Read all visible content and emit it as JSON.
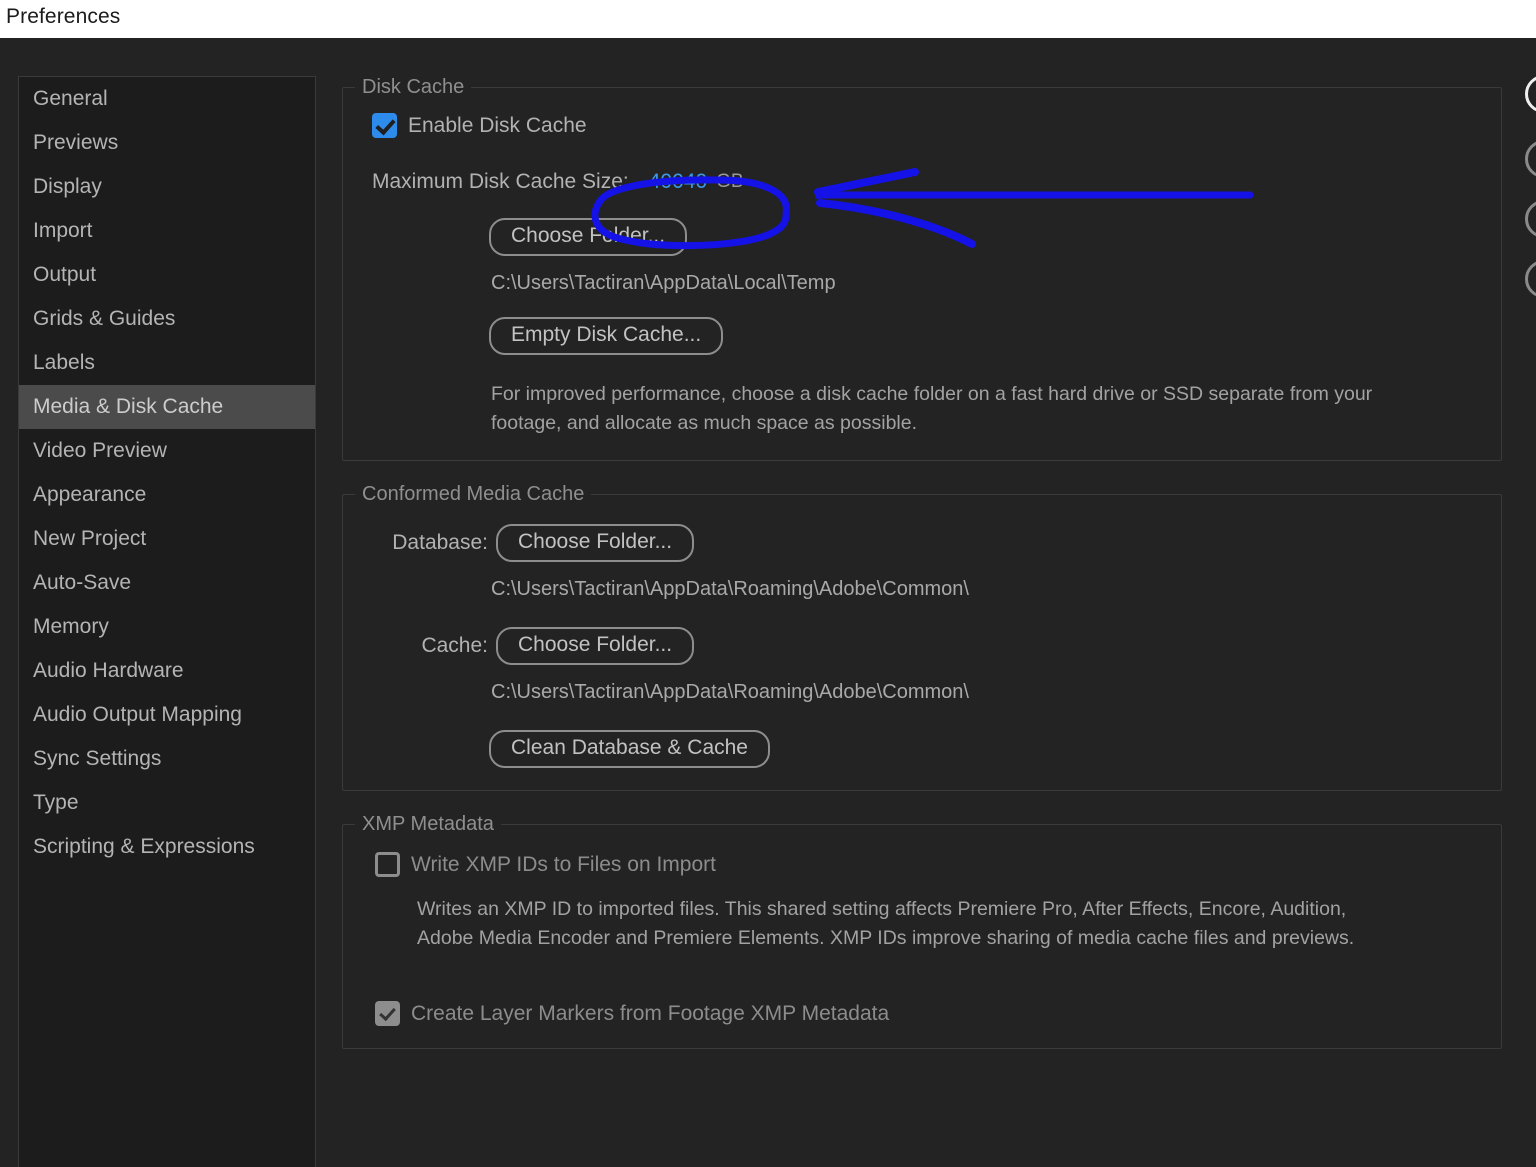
{
  "window": {
    "title": "Preferences"
  },
  "sidebar": {
    "items": [
      {
        "label": "General",
        "selected": false
      },
      {
        "label": "Previews",
        "selected": false
      },
      {
        "label": "Display",
        "selected": false
      },
      {
        "label": "Import",
        "selected": false
      },
      {
        "label": "Output",
        "selected": false
      },
      {
        "label": "Grids & Guides",
        "selected": false
      },
      {
        "label": "Labels",
        "selected": false
      },
      {
        "label": "Media & Disk Cache",
        "selected": true
      },
      {
        "label": "Video Preview",
        "selected": false
      },
      {
        "label": "Appearance",
        "selected": false
      },
      {
        "label": "New Project",
        "selected": false
      },
      {
        "label": "Auto-Save",
        "selected": false
      },
      {
        "label": "Memory",
        "selected": false
      },
      {
        "label": "Audio Hardware",
        "selected": false
      },
      {
        "label": "Audio Output Mapping",
        "selected": false
      },
      {
        "label": "Sync Settings",
        "selected": false
      },
      {
        "label": "Type",
        "selected": false
      },
      {
        "label": "Scripting & Expressions",
        "selected": false
      }
    ]
  },
  "disk_cache": {
    "legend": "Disk Cache",
    "enable_label": "Enable Disk Cache",
    "enable_checked": true,
    "max_size_label": "Maximum Disk Cache Size:",
    "max_size_value": "40040",
    "max_size_unit": "GB",
    "choose_folder_label": "Choose Folder...",
    "cache_path": "C:\\Users\\Tactiran\\AppData\\Local\\Temp",
    "empty_disk_cache_label": "Empty Disk Cache...",
    "help_line1": "For improved performance, choose a disk cache folder on a fast hard drive or SSD separate from your",
    "help_line2": "footage, and allocate as much space as possible."
  },
  "conformed_media_cache": {
    "legend": "Conformed Media Cache",
    "database_label": "Database:",
    "database_button": "Choose Folder...",
    "database_path": "C:\\Users\\Tactiran\\AppData\\Roaming\\Adobe\\Common\\",
    "cache_label": "Cache:",
    "cache_button": "Choose Folder...",
    "cache_path": "C:\\Users\\Tactiran\\AppData\\Roaming\\Adobe\\Common\\",
    "clean_button": "Clean Database & Cache"
  },
  "xmp_metadata": {
    "legend": "XMP Metadata",
    "write_ids_label": "Write XMP IDs to Files on Import",
    "write_ids_checked": false,
    "write_ids_help_line1": "Writes an XMP ID to imported files. This shared setting affects Premiere Pro, After Effects, Encore, Audition,",
    "write_ids_help_line2": "Adobe Media Encoder and Premiere Elements. XMP IDs improve sharing of media cache files and previews.",
    "layer_markers_label": "Create Layer Markers from Footage XMP Metadata",
    "layer_markers_checked": true
  },
  "annotation": {
    "color": "#1512E8",
    "shapes": [
      "ellipse-around-max-disk-cache-size",
      "arrow-pointing-left"
    ]
  },
  "colors": {
    "accent_checkbox": "#2d8ceb",
    "value_text": "#3d9ae8",
    "selection_bg": "#4b4b4b",
    "panel_bg": "#232323",
    "sidebar_bg": "#1c1c1c",
    "annotation": "#1512E8"
  }
}
